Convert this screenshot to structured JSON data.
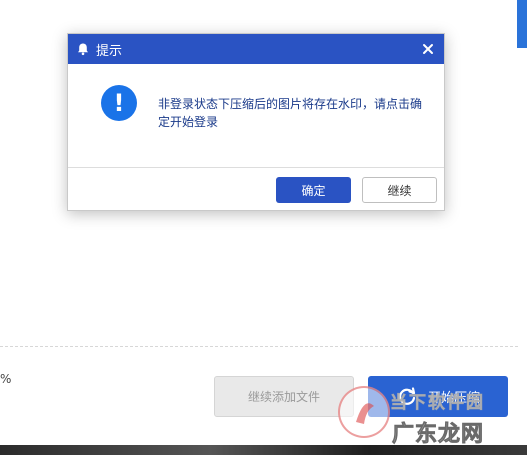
{
  "background": {
    "percent_text": "%",
    "add_files_label": "继续添加文件",
    "start_label": "开始压缩",
    "start_icon": "refresh-icon"
  },
  "watermark": {
    "top_text": "当下软件园",
    "bottom_text": "广东龙网"
  },
  "dialog": {
    "title": "提示",
    "title_icon": "bell-icon",
    "close_icon": "close-icon",
    "status_icon": "info-icon",
    "status_glyph": "!",
    "message": "非登录状态下压缩后的图片将存在水印，请点击确定开始登录",
    "confirm_label": "确定",
    "continue_label": "继续"
  },
  "colors": {
    "accent": "#2a53c3",
    "info_icon": "#1a73e8",
    "start_button": "#2a63d2"
  }
}
